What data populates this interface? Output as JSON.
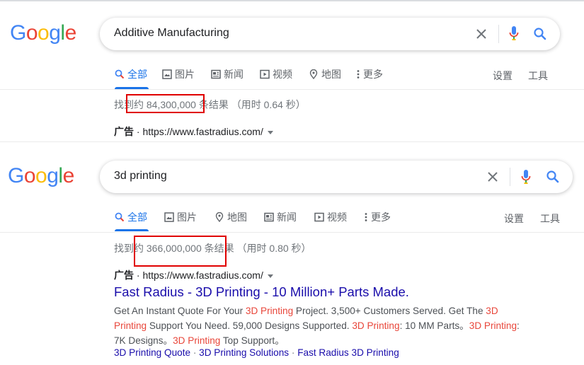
{
  "colors": {
    "blue": "#4285F4",
    "red": "#EA4335",
    "yellow": "#FBBC05",
    "green": "#34A853",
    "link": "#1a0dab",
    "accent": "#1a73e8",
    "highlight": "#e8463a",
    "annotation_red": "#e00000"
  },
  "logo": {
    "letters": [
      "G",
      "o",
      "o",
      "g",
      "l",
      "e"
    ]
  },
  "panels": [
    {
      "query": "Additive Manufacturing",
      "tabs": [
        {
          "label": "全部",
          "icon": "search-icon",
          "active": true
        },
        {
          "label": "图片",
          "icon": "image-icon"
        },
        {
          "label": "新闻",
          "icon": "news-icon"
        },
        {
          "label": "视频",
          "icon": "video-icon"
        },
        {
          "label": "地图",
          "icon": "map-pin-icon"
        },
        {
          "label": "更多",
          "icon": "more-vert-icon"
        }
      ],
      "settings": "设置",
      "tools": "工具",
      "stats": {
        "prefix": "找到约 ",
        "count": "84,300,000",
        "suffix": " 条结果  （用时 0.64 秒）"
      },
      "ad": {
        "label": "广告",
        "url": "https://www.fastradius.com/"
      }
    },
    {
      "query": "3d printing",
      "tabs": [
        {
          "label": "全部",
          "icon": "search-icon",
          "active": true
        },
        {
          "label": "图片",
          "icon": "image-icon"
        },
        {
          "label": "地图",
          "icon": "map-pin-icon"
        },
        {
          "label": "新闻",
          "icon": "news-icon"
        },
        {
          "label": "视频",
          "icon": "video-icon"
        },
        {
          "label": "更多",
          "icon": "more-vert-icon"
        }
      ],
      "settings": "设置",
      "tools": "工具",
      "stats": {
        "prefix": "找到约 ",
        "count": "366,000,000",
        "suffix": " 条结果  （用时 0.80 秒）"
      },
      "ad": {
        "label": "广告",
        "url": "https://www.fastradius.com/",
        "title": "Fast Radius - 3D Printing - 10 Million+ Parts Made.",
        "desc": [
          {
            "t": "Get An Instant Quote For Your "
          },
          {
            "t": "3D Printing",
            "hl": true
          },
          {
            "t": " Project. 3,500+ Customers Served. Get The "
          },
          {
            "t": "3D Printing",
            "hl": true
          },
          {
            "t": " Support You Need. 59,000 Designs Supported. "
          },
          {
            "t": "3D Printing",
            "hl": true
          },
          {
            "t": ": 10 MM Parts。"
          },
          {
            "t": "3D Printing",
            "hl": true
          },
          {
            "t": ": 7K Designs。"
          },
          {
            "t": "3D Printing",
            "hl": true
          },
          {
            "t": " Top Support。"
          }
        ],
        "sitelinks": [
          "3D Printing Quote",
          "3D Printing Solutions",
          "Fast Radius 3D Printing"
        ],
        "sitelink_sep": " · "
      }
    }
  ]
}
